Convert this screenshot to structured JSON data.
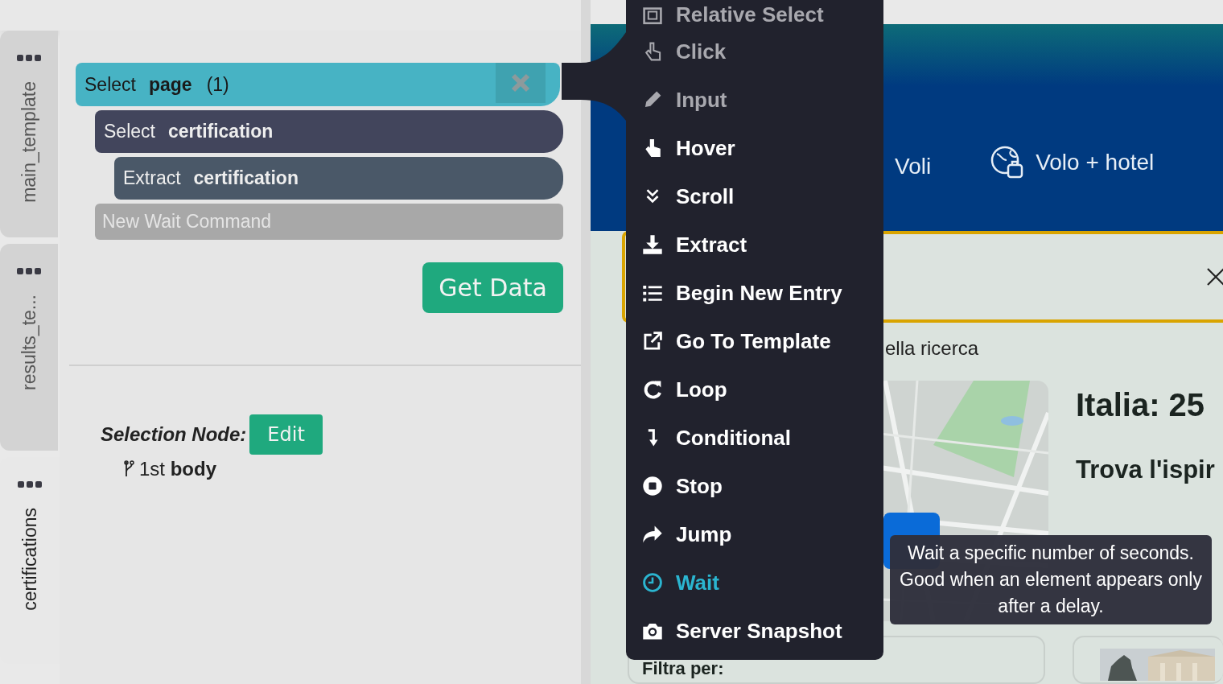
{
  "template_tabs": [
    {
      "label": "main_template",
      "selected": false
    },
    {
      "label": "results_te...",
      "selected": false
    },
    {
      "label": "certifications",
      "selected": true
    }
  ],
  "commands": [
    {
      "kind": "command",
      "verb": "Select",
      "target": "page",
      "count": "(1)",
      "selected": true,
      "children": [
        {
          "kind": "command",
          "verb": "Select",
          "target": "certification",
          "selected": false,
          "children": [
            {
              "kind": "command",
              "verb": "Extract",
              "target": "certification",
              "selected": false
            }
          ]
        },
        {
          "kind": "new",
          "label": "New Wait Command"
        }
      ]
    }
  ],
  "get_data_button": "Get Data",
  "selection_node": {
    "label": "Selection Node:",
    "edit_button": "Edit",
    "node": "1st **body**"
  },
  "command_menu": [
    {
      "label": "Relative Select",
      "disabled": true,
      "selected": false
    },
    {
      "label": "Click",
      "disabled": true,
      "selected": false
    },
    {
      "label": "Input",
      "disabled": true,
      "selected": false
    },
    {
      "label": "Hover",
      "disabled": false,
      "selected": false
    },
    {
      "label": "Scroll",
      "disabled": false,
      "selected": false
    },
    {
      "label": "Extract",
      "disabled": false,
      "selected": false
    },
    {
      "label": "Begin New Entry",
      "disabled": false,
      "selected": false
    },
    {
      "label": "Go To Template",
      "disabled": false,
      "selected": false
    },
    {
      "label": "Loop",
      "disabled": false,
      "selected": false
    },
    {
      "label": "Conditional",
      "disabled": false,
      "selected": false
    },
    {
      "label": "Stop",
      "disabled": false,
      "selected": false
    },
    {
      "label": "Jump",
      "disabled": false,
      "selected": false
    },
    {
      "label": "Wait",
      "disabled": false,
      "selected": true
    },
    {
      "label": "Server Snapshot",
      "disabled": false,
      "selected": false
    }
  ],
  "tooltip": "Wait a specific number of seconds. Good when an element appears only after a delay.",
  "web_page": {
    "nav": [
      "Voli",
      "Volo + hotel"
    ],
    "search_text": "ella ricerca",
    "headline": "Italia: 25",
    "subheading": "Trova l'ispir",
    "filter_title": "Filtra per:"
  }
}
